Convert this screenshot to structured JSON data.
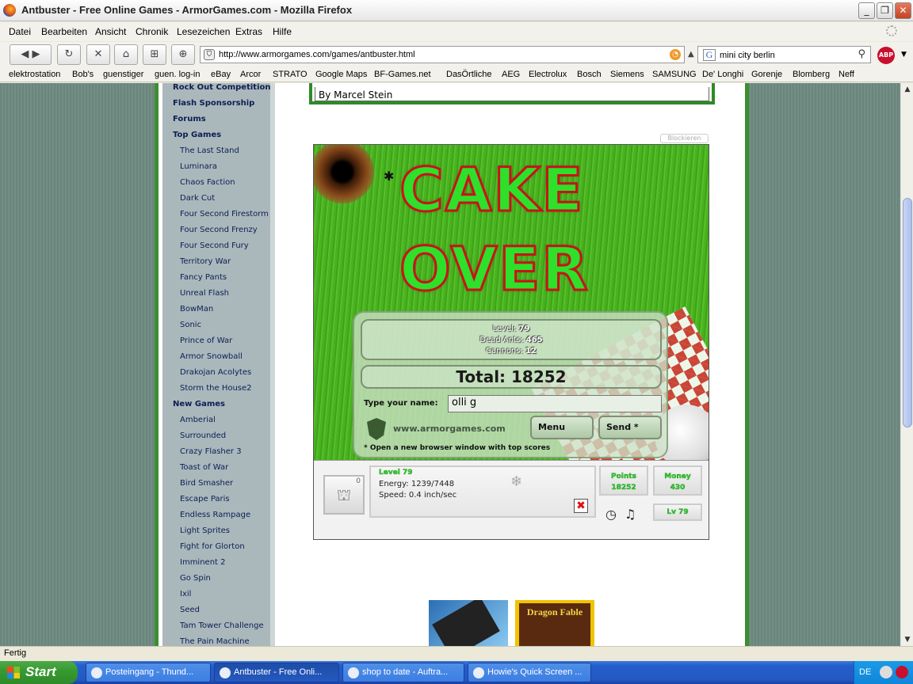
{
  "window": {
    "title": "Antbuster - Free Online Games - ArmorGames.com - Mozilla Firefox"
  },
  "menu": [
    "Datei",
    "Bearbeiten",
    "Ansicht",
    "Chronik",
    "Lesezeichen",
    "Extras",
    "Hilfe"
  ],
  "nav": {
    "url": "http://www.armorgames.com/games/antbuster.html",
    "search_value": "mini city berlin",
    "abp_label": "ABP"
  },
  "bookmarks": [
    "elektrostation",
    "Bob's",
    "guenstiger",
    "guen. log-in",
    "eBay",
    "Arcor",
    "STRATO",
    "Google Maps",
    "BF-Games.net",
    "DasÖrtliche",
    "AEG",
    "Electrolux",
    "Bosch",
    "Siemens",
    "SAMSUNG",
    "De' Longhi",
    "Gorenje",
    "Blomberg",
    "Neff"
  ],
  "sidebar": {
    "links_top": [
      "Rock Out Competition",
      "Flash Sponsorship",
      "Forums"
    ],
    "top_games_heading": "Top Games",
    "top_games": [
      "The Last Stand",
      "Luminara",
      "Chaos Faction",
      "Dark Cut",
      "Four Second Firestorm",
      "Four Second Frenzy",
      "Four Second Fury",
      "Territory War",
      "Fancy Pants",
      "Unreal Flash",
      "BowMan",
      "Sonic",
      "Prince of War",
      "Armor Snowball",
      "Drakojan Acolytes",
      "Storm the House2"
    ],
    "new_games_heading": "New Games",
    "new_games": [
      "Amberial",
      "Surrounded",
      "Crazy Flasher 3",
      "Toast of War",
      "Bird Smasher",
      "Escape Paris",
      "Endless Rampage",
      "Light Sprites",
      "Fight for Glorton",
      "Imminent 2",
      "Go Spin",
      "Ixil",
      "Seed",
      "Tam Tower Challenge",
      "The Pain Machine"
    ]
  },
  "main": {
    "author": "By Marcel Stein",
    "block_label": "Blockieren"
  },
  "game": {
    "headline_1": "CAKE",
    "headline_2": "OVER",
    "level_label": "Level:",
    "level": "79",
    "dead_ants_label": "Dead Ants:",
    "dead_ants": "465",
    "cannons_label": "Cannons:",
    "cannons": "12",
    "total": "Total: 18252",
    "name_label": "Type your name:",
    "name_value": "olli g",
    "site": "www.armorgames.com",
    "menu_button": "Menu",
    "send_button": "Send *",
    "note": "* Open a new browser window with top scores",
    "hud": {
      "cannon_count": "0",
      "level": "Level 79",
      "energy": "Energy: 1239/7448",
      "speed": "Speed: 0.4 inch/sec",
      "points_label": "Points",
      "points": "18252",
      "money_label": "Money",
      "money": "430",
      "lv": "Lv 79"
    }
  },
  "ads": {
    "dragon_fable": "Dragon Fable"
  },
  "status": "Fertig",
  "taskbar": {
    "start": "Start",
    "tasks": [
      "Posteingang - Thund...",
      "Antbuster - Free Onli...",
      "shop to date - Auftra...",
      "Howie's Quick Screen ..."
    ],
    "lang": "DE"
  }
}
